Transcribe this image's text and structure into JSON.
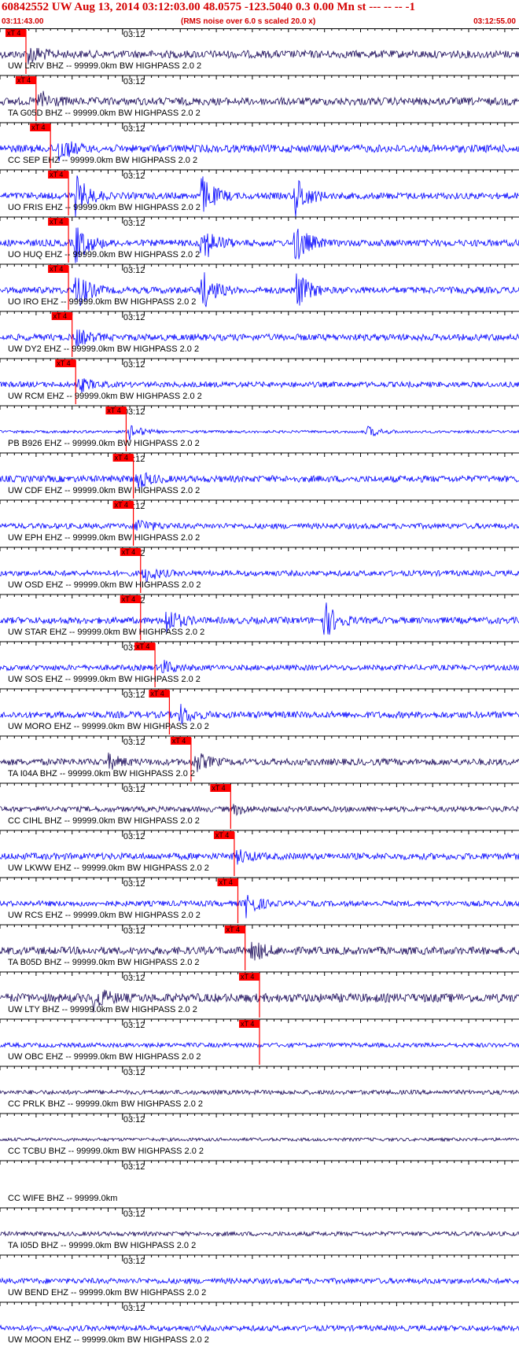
{
  "header": {
    "title": "60842552 UW Aug 13, 2014 03:12:03.00   48.0575 -123.5040  0.3 0.00 Mn st --- -- --  -1",
    "start_time": "03:11:43.00",
    "note": "(RMS noise over 6.0 s scaled 20.0 x)",
    "end_time": "03:12:55.00"
  },
  "colors": {
    "trace_blue": "#0000ff",
    "trace_navy": "#1a0a5a",
    "pick": "#ff0000",
    "header_text": "#d40000"
  },
  "chart_data": {
    "type": "line",
    "title": "60842552 UW Aug 13, 2014 03:12:03.00   48.0575 -123.5040  0.3 0.00 Mn st --- -- --  -1",
    "x_range": [
      "03:11:43.00",
      "03:12:55.00"
    ],
    "minute_mark_label": "03:12",
    "pick_label": "xT 4",
    "series": [
      {
        "label": "UW LRIV BHZ -- 99999.0km BW  HIGHPASS  2.0  2",
        "color": "#1a0a5a",
        "pick": "03:11:46.6",
        "amp": 0.35,
        "bursts": [
          {
            "t": "03:11:47.0",
            "amp": 0.8
          }
        ]
      },
      {
        "label": "TA G05D BHZ -- 99999.0km BW  HIGHPASS  2.0  2",
        "color": "#1a0a5a",
        "pick": "03:11:48.0",
        "amp": 0.35,
        "bursts": [
          {
            "t": "03:11:48.5",
            "amp": 0.9
          }
        ]
      },
      {
        "label": "CC SEP EHZ -- 99999.0km BW  HIGHPASS  2.0  2",
        "color": "#0000ff",
        "pick": "03:11:50.0",
        "amp": 0.35,
        "bursts": [
          {
            "t": "03:11:51.0",
            "amp": 1.2
          }
        ]
      },
      {
        "label": "UO FRIS EHZ -- 99999.0km BW  HIGHPASS  2.0  2",
        "color": "#0000ff",
        "pick": "03:11:52.5",
        "amp": 0.3,
        "bursts": [
          {
            "t": "03:11:53.5",
            "amp": 1.8
          },
          {
            "t": "03:12:11.0",
            "amp": 1.8
          },
          {
            "t": "03:12:24.0",
            "amp": 1.8
          }
        ]
      },
      {
        "label": "UO HUQ EHZ -- 99999.0km BW  HIGHPASS  2.0  2",
        "color": "#0000ff",
        "pick": "03:11:52.5",
        "amp": 0.3,
        "bursts": [
          {
            "t": "03:11:53.5",
            "amp": 1.8
          },
          {
            "t": "03:12:11.0",
            "amp": 1.8
          },
          {
            "t": "03:12:24.0",
            "amp": 1.8
          }
        ]
      },
      {
        "label": "UO IRO EHZ -- 99999.0km BW  HIGHPASS  2.0  2",
        "color": "#0000ff",
        "pick": "03:11:52.5",
        "amp": 0.3,
        "bursts": [
          {
            "t": "03:11:53.5",
            "amp": 1.8
          },
          {
            "t": "03:12:11.0",
            "amp": 1.8
          },
          {
            "t": "03:12:24.0",
            "amp": 1.8
          }
        ]
      },
      {
        "label": "UW DY2 EHZ -- 99999.0km BW  HIGHPASS  2.0  2",
        "color": "#0000ff",
        "pick": "03:11:53.0",
        "amp": 0.3,
        "bursts": [
          {
            "t": "03:11:53.5",
            "amp": 0.8
          }
        ]
      },
      {
        "label": "UW RCM EHZ -- 99999.0km BW  HIGHPASS  2.0  2",
        "color": "#0000ff",
        "pick": "03:11:53.5",
        "amp": 0.25,
        "bursts": [
          {
            "t": "03:11:54.0",
            "amp": 0.6
          }
        ]
      },
      {
        "label": "PB B926 EHZ -- 99999.0km BW  HIGHPASS  2.0  2",
        "color": "#0000ff",
        "pick": "03:12:00.5",
        "amp": 0.12,
        "bursts": [
          {
            "t": "03:12:01.0",
            "amp": 0.7
          },
          {
            "t": "03:12:34.0",
            "amp": 0.5
          }
        ]
      },
      {
        "label": "UW CDF EHZ -- 99999.0km BW  HIGHPASS  2.0  2",
        "color": "#0000ff",
        "pick": "03:12:01.5",
        "amp": 0.3,
        "bursts": [
          {
            "t": "03:12:02.0",
            "amp": 0.8
          }
        ]
      },
      {
        "label": "UW EPH EHZ -- 99999.0km BW  HIGHPASS  2.0  2",
        "color": "#0000ff",
        "pick": "03:12:01.5",
        "amp": 0.25,
        "bursts": [
          {
            "t": "03:12:02.0",
            "amp": 0.7
          }
        ]
      },
      {
        "label": "UW OSD EHZ -- 99999.0km BW  HIGHPASS  2.0  2",
        "color": "#0000ff",
        "pick": "03:12:02.5",
        "amp": 0.25,
        "bursts": [
          {
            "t": "03:12:03.0",
            "amp": 0.8
          }
        ]
      },
      {
        "label": "UW STAR EHZ -- 99999.0km BW  HIGHPASS  2.0  2",
        "color": "#0000ff",
        "pick": "03:12:02.5",
        "amp": 0.3,
        "bursts": [
          {
            "t": "03:12:06.0",
            "amp": 1.2
          },
          {
            "t": "03:12:28.0",
            "amp": 1.6
          }
        ]
      },
      {
        "label": "UW SOS EHZ -- 99999.0km BW  HIGHPASS  2.0  2",
        "color": "#0000ff",
        "pick": "03:12:04.5",
        "amp": 0.25,
        "bursts": [
          {
            "t": "03:12:05.5",
            "amp": 0.6
          }
        ]
      },
      {
        "label": "UW MORO EHZ -- 99999.0km BW  HIGHPASS  2.0  2",
        "color": "#0000ff",
        "pick": "03:12:06.5",
        "amp": 0.3,
        "bursts": [
          {
            "t": "03:12:08.0",
            "amp": 0.8
          }
        ]
      },
      {
        "label": "TA I04A BHZ -- 99999.0km BW  HIGHPASS  2.0  2",
        "color": "#1a0a5a",
        "pick": "03:12:09.5",
        "amp": 0.3,
        "bursts": [
          {
            "t": "03:11:58.0",
            "amp": 0.6
          },
          {
            "t": "03:12:10.0",
            "amp": 0.9
          }
        ]
      },
      {
        "label": "CC CIHL BHZ -- 99999.0km BW  HIGHPASS  2.0  2",
        "color": "#1a0a5a",
        "pick": "03:12:15.0",
        "amp": 0.25,
        "bursts": [
          {
            "t": "03:12:15.5",
            "amp": 0.4
          }
        ]
      },
      {
        "label": "UW LKWW EHZ -- 99999.0km BW  HIGHPASS  2.0  2",
        "color": "#0000ff",
        "pick": "03:12:15.5",
        "amp": 0.3,
        "bursts": [
          {
            "t": "03:12:16.0",
            "amp": 0.6
          }
        ]
      },
      {
        "label": "UW RCS EHZ -- 99999.0km BW  HIGHPASS  2.0  2",
        "color": "#0000ff",
        "pick": "03:12:16.0",
        "amp": 0.25,
        "bursts": [
          {
            "t": "03:12:17.0",
            "amp": 1.2
          }
        ]
      },
      {
        "label": "TA B05D BHZ -- 99999.0km BW  HIGHPASS  2.0  2",
        "color": "#1a0a5a",
        "pick": "03:12:17.0",
        "amp": 0.35,
        "bursts": [
          {
            "t": "03:12:18.0",
            "amp": 0.9
          }
        ]
      },
      {
        "label": "UW LTY BHZ -- 99999.0km BW  HIGHPASS  2.0  2",
        "color": "#1a0a5a",
        "pick": "03:12:19.0",
        "amp": 0.4,
        "bursts": [
          {
            "t": "03:11:56.0",
            "amp": 1.0
          }
        ]
      },
      {
        "label": "UW OBC EHZ -- 99999.0km BW  HIGHPASS  2.0  2",
        "color": "#0000ff",
        "pick": "03:12:19.0",
        "amp": 0.2,
        "bursts": []
      },
      {
        "label": "CC PRLK BHZ -- 99999.0km BW  HIGHPASS  2.0  2",
        "color": "#1a0a5a",
        "pick": null,
        "amp": 0.2,
        "bursts": []
      },
      {
        "label": "CC TCBU BHZ -- 99999.0km BW  HIGHPASS  2.0  2",
        "color": "#1a0a5a",
        "pick": null,
        "amp": 0.15,
        "bursts": []
      },
      {
        "label": "CC WIFE BHZ -- 99999.0km",
        "color": "#1a0a5a",
        "pick": null,
        "amp": 0.0,
        "bursts": []
      },
      {
        "label": "TA I05D BHZ -- 99999.0km BW  HIGHPASS  2.0  2",
        "color": "#1a0a5a",
        "pick": null,
        "amp": 0.2,
        "bursts": []
      },
      {
        "label": "UW BEND EHZ -- 99999.0km BW  HIGHPASS  2.0  2",
        "color": "#0000ff",
        "pick": null,
        "amp": 0.25,
        "bursts": []
      },
      {
        "label": "UW MOON EHZ -- 99999.0km BW  HIGHPASS  2.0  2",
        "color": "#0000ff",
        "pick": null,
        "amp": 0.25,
        "bursts": []
      }
    ]
  }
}
